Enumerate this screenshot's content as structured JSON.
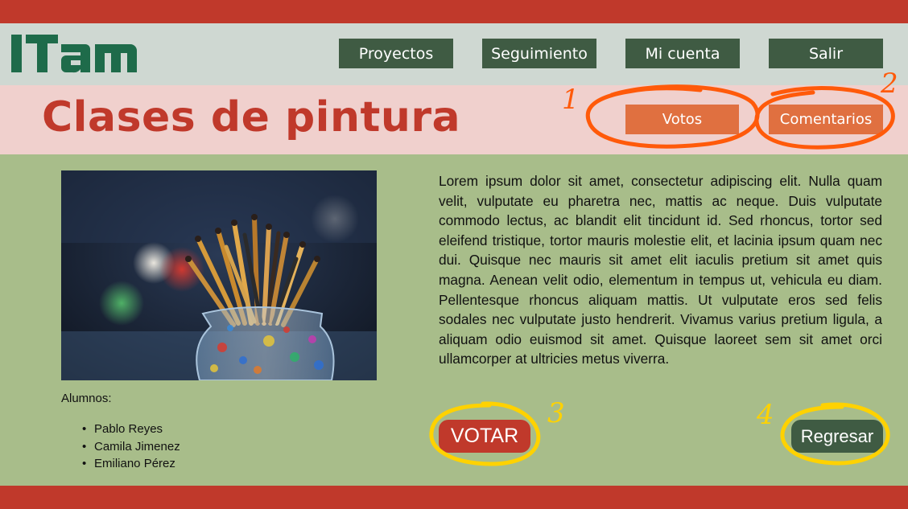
{
  "colors": {
    "brand_red": "#c0392b",
    "nav_green": "#3f5b43",
    "header_gray": "#cfd8d2",
    "title_pink": "#f0d0cd",
    "content_green": "#a8bd8a",
    "action_orange": "#e07040",
    "annotation_orange": "#ff5a0a",
    "annotation_yellow": "#ffd200"
  },
  "logo": {
    "text": "ITAM",
    "icon": "itam-logo"
  },
  "nav": {
    "items": [
      {
        "label": "Proyectos"
      },
      {
        "label": "Seguimiento"
      },
      {
        "label": "Mi cuenta"
      },
      {
        "label": "Salir"
      }
    ]
  },
  "page": {
    "title": "Clases de pintura",
    "votos_label": "Votos",
    "comentarios_label": "Comentarios"
  },
  "annotations": {
    "n1": "1",
    "n2": "2",
    "n3": "3",
    "n4": "4"
  },
  "photo": {
    "icon": "paint-brushes-jar-photo"
  },
  "students": {
    "label": "Alumnos:",
    "names": [
      "Pablo Reyes",
      "Camila Jimenez",
      "Emiliano Pérez"
    ]
  },
  "description": "Lorem ipsum dolor sit amet, consectetur adipiscing elit. Nulla quam velit, vulputate eu pharetra nec, mattis ac neque. Duis vulputate commodo lectus, ac blandit elit tincidunt id. Sed rhoncus, tortor sed eleifend tristique, tortor mauris molestie elit, et lacinia ipsum quam nec dui. Quisque nec mauris sit amet elit iaculis pretium sit amet quis magna. Aenean velit odio, elementum in tempus ut, vehicula eu diam. Pellentesque rhoncus aliquam mattis. Ut vulputate eros sed felis sodales nec vulputate justo hendrerit. Vivamus varius pretium ligula, a aliquam odio euismod sit amet. Quisque laoreet sem sit amet orci ullamcorper at ultricies metus viverra.",
  "actions": {
    "votar_label": "VOTAR",
    "regresar_label": "Regresar"
  }
}
